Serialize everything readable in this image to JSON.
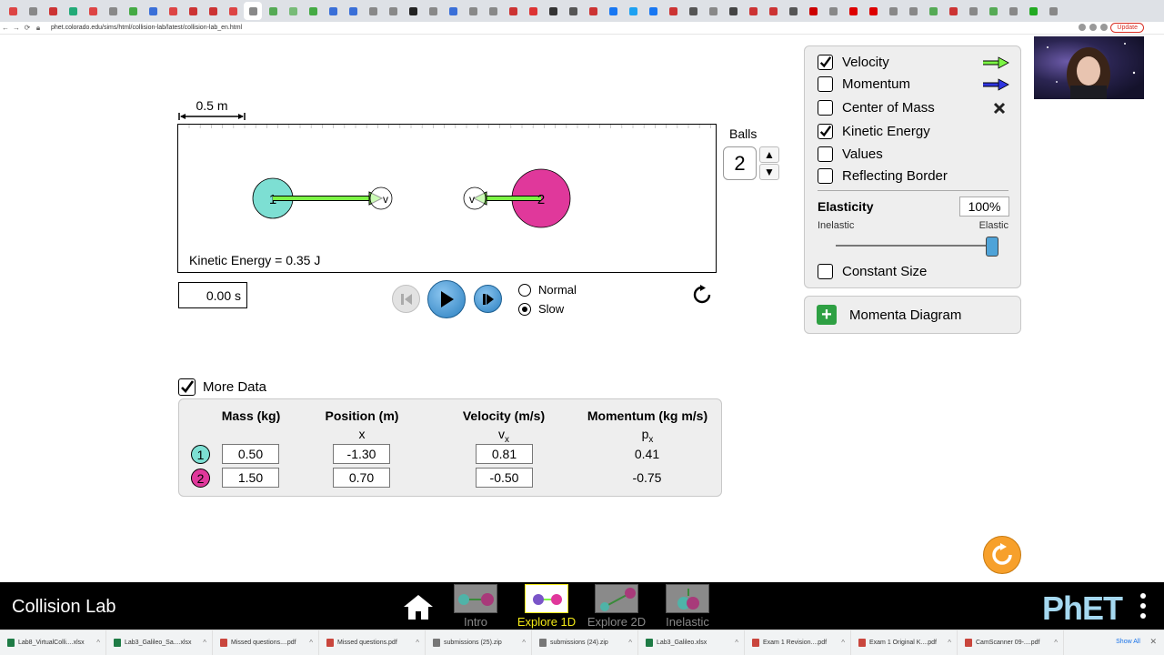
{
  "browser": {
    "url": "phet.colorado.edu/sims/html/collision-lab/latest/collision-lab_en.html",
    "update_label": "Update"
  },
  "sim": {
    "ruler_label": "0.5 m",
    "kinetic_energy_text": "Kinetic Energy = 0.35 J",
    "balls_label": "Balls",
    "balls_count": "2",
    "timer": "0.00 s",
    "speed_normal": "Normal",
    "speed_slow": "Slow",
    "speed_selected": "Slow",
    "ball1_label": "1",
    "ball2_label": "2",
    "vector_label": "v",
    "ball1_color": "#7ddfd3",
    "ball2_color": "#e0389b"
  },
  "panel": {
    "velocity": {
      "label": "Velocity",
      "checked": true,
      "arrow_color": "#7cf545"
    },
    "momentum": {
      "label": "Momentum",
      "checked": false,
      "arrow_color": "#2f35e0"
    },
    "center_of_mass": {
      "label": "Center of Mass",
      "checked": false
    },
    "kinetic_energy": {
      "label": "Kinetic Energy",
      "checked": true
    },
    "values": {
      "label": "Values",
      "checked": false
    },
    "reflecting_border": {
      "label": "Reflecting Border",
      "checked": false
    },
    "elasticity_label": "Elasticity",
    "elasticity_value": "100%",
    "elasticity_level": 1.0,
    "inelastic_label": "Inelastic",
    "elastic_label": "Elastic",
    "constant_size": {
      "label": "Constant Size",
      "checked": false
    }
  },
  "momenta_diagram": {
    "label": "Momenta Diagram"
  },
  "more_data": {
    "label": "More Data",
    "checked": true,
    "headers": {
      "mass": "Mass (kg)",
      "position": "Position (m)",
      "position_sub": "x",
      "velocity": "Velocity (m/s)",
      "velocity_sub_base": "v",
      "velocity_sub_index": "x",
      "momentum": "Momentum (kg m/s)",
      "momentum_sub_base": "p",
      "momentum_sub_index": "x"
    },
    "rows": [
      {
        "ball": "1",
        "mass": "0.50",
        "position": "-1.30",
        "velocity": "0.81",
        "momentum": "0.41"
      },
      {
        "ball": "2",
        "mass": "1.50",
        "position": "0.70",
        "velocity": "-0.50",
        "momentum": "-0.75"
      }
    ]
  },
  "navbar": {
    "title": "Collision Lab",
    "screens": [
      {
        "label": "Intro",
        "active": false
      },
      {
        "label": "Explore 1D",
        "active": true
      },
      {
        "label": "Explore 2D",
        "active": false
      },
      {
        "label": "Inelastic",
        "active": false
      }
    ],
    "logo": "PhET"
  },
  "downloads": {
    "items": [
      "Lab8_VirtualColli....xlsx",
      "Lab3_Galileo_Sa....xlsx",
      "Missed questions....pdf",
      "Missed questions.pdf",
      "submissions (25).zip",
      "submissions (24).zip",
      "Lab3_Galileo.xlsx",
      "Exam 1 Revision....pdf",
      "Exam 1 Original K....pdf",
      "CamScanner 09-....pdf"
    ],
    "show_all": "Show All"
  }
}
